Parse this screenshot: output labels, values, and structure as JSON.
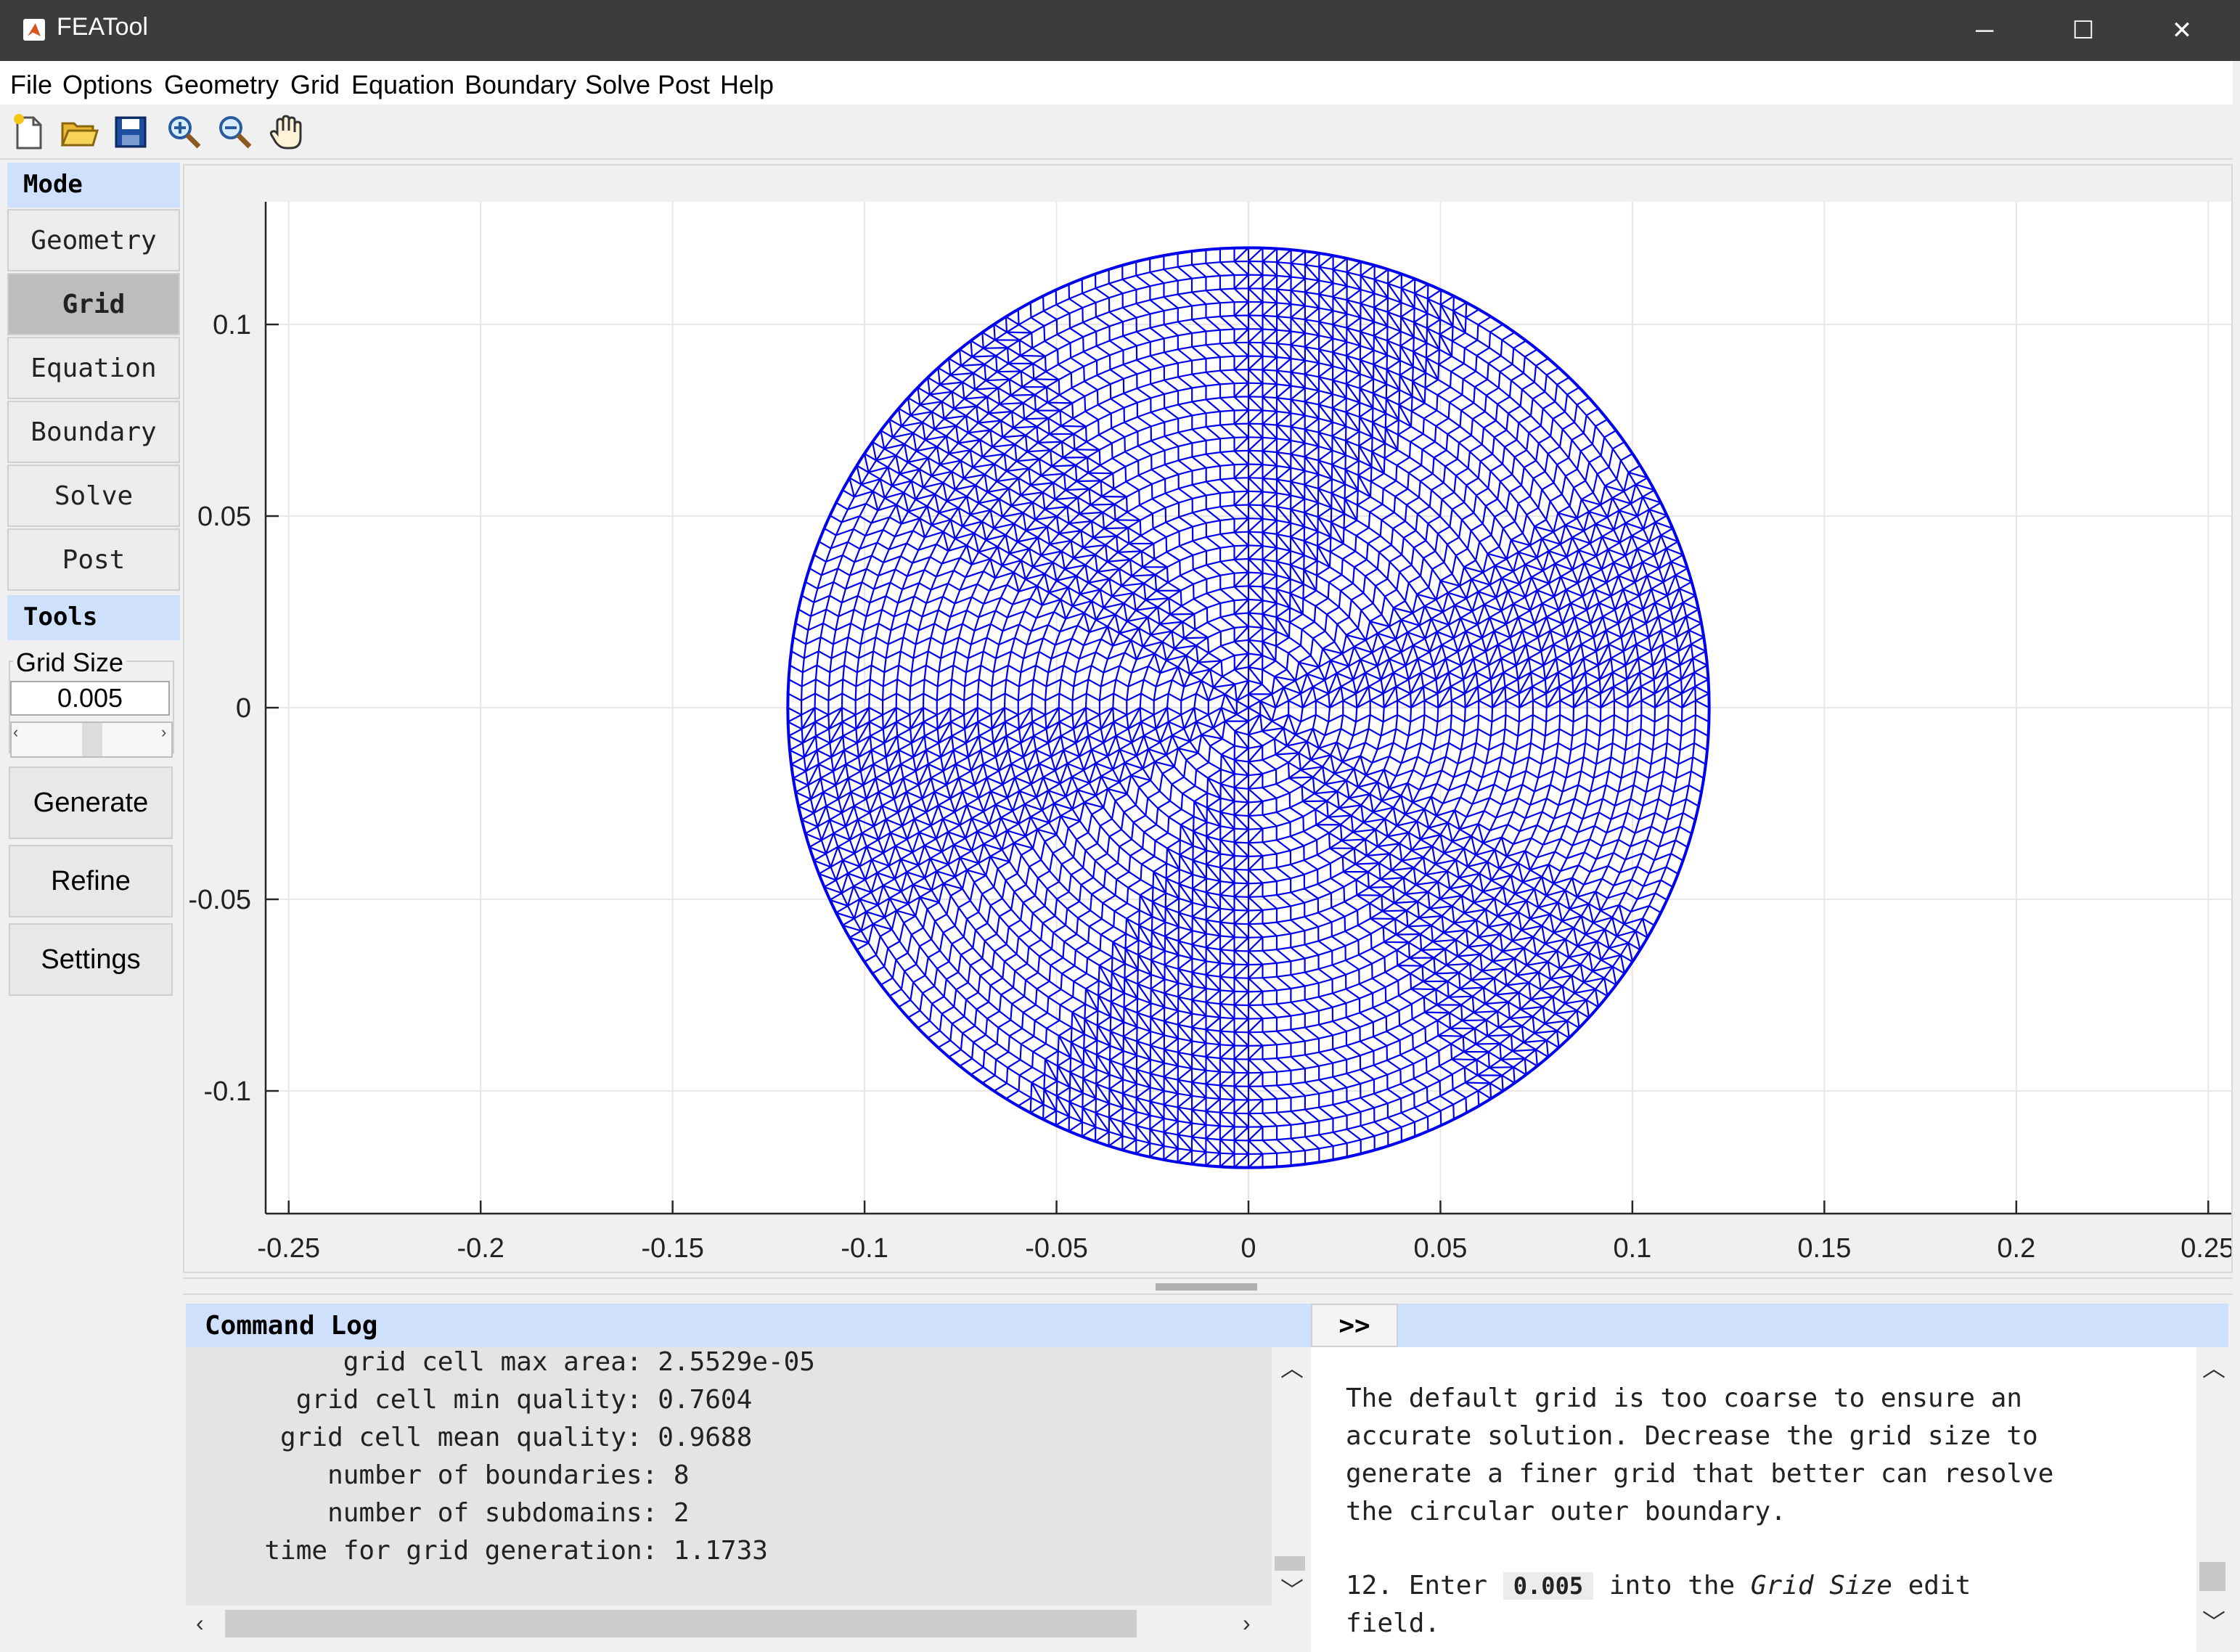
{
  "window": {
    "title": "FEATool",
    "minimize_glyph": "─",
    "maximize_glyph": "☐",
    "close_glyph": "✕"
  },
  "menubar": [
    "File",
    "Options",
    "Geometry",
    "Grid",
    "Equation",
    "Boundary",
    "Solve",
    "Post",
    "Help"
  ],
  "toolbar": {
    "icons": [
      "new-file-icon",
      "open-folder-icon",
      "save-icon",
      "zoom-in-icon",
      "zoom-out-icon",
      "pan-hand-icon"
    ]
  },
  "sidebar": {
    "mode_header": "Mode",
    "modes": [
      {
        "label": "Geometry",
        "active": false
      },
      {
        "label": "Grid",
        "active": true
      },
      {
        "label": "Equation",
        "active": false
      },
      {
        "label": "Boundary",
        "active": false
      },
      {
        "label": "Solve",
        "active": false
      },
      {
        "label": "Post",
        "active": false
      }
    ],
    "tools_header": "Tools",
    "grid_size_label": "Grid Size",
    "grid_size_value": "0.005",
    "slider_level": 0.5,
    "tool_buttons": [
      "Generate",
      "Refine",
      "Settings"
    ]
  },
  "plot": {
    "x_ticks": [
      "-0.25",
      "-0.2",
      "-0.15",
      "-0.1",
      "-0.05",
      "0",
      "0.05",
      "0.1",
      "0.15",
      "0.2",
      "0.25"
    ],
    "x_tick_values": [
      -0.25,
      -0.2,
      -0.15,
      -0.1,
      -0.05,
      0,
      0.05,
      0.1,
      0.15,
      0.2,
      0.25
    ],
    "y_ticks": [
      "0.1",
      "0.05",
      "0",
      "-0.05",
      "-0.1"
    ],
    "y_tick_values": [
      0.1,
      0.05,
      0,
      -0.05,
      -0.1
    ],
    "xlim": [
      -0.256,
      0.256
    ],
    "ylim": [
      -0.132,
      0.132
    ],
    "mesh_color": "#0000ee",
    "circle_radius": 0.12
  },
  "command_log": {
    "header": "Command Log",
    "lines": [
      "          grid cell max area: 2.5529e-05",
      "       grid cell min quality: 0.7604",
      "      grid cell mean quality: 0.9688",
      "         number of boundaries: 8",
      "         number of subdomains: 2",
      "     time for grid generation: 1.1733"
    ]
  },
  "help": {
    "expand_label": ">>",
    "lines": [
      "The default grid is too coarse to ensure an",
      "accurate solution. Decrease the grid size to",
      "generate a finer grid that better can resolve",
      "the circular outer boundary."
    ],
    "step_prefix": "12. Enter",
    "step_code": "0.005",
    "step_mid": "into the",
    "step_italic": "Grid Size",
    "step_suffix": "edit",
    "step_line2": "field."
  }
}
